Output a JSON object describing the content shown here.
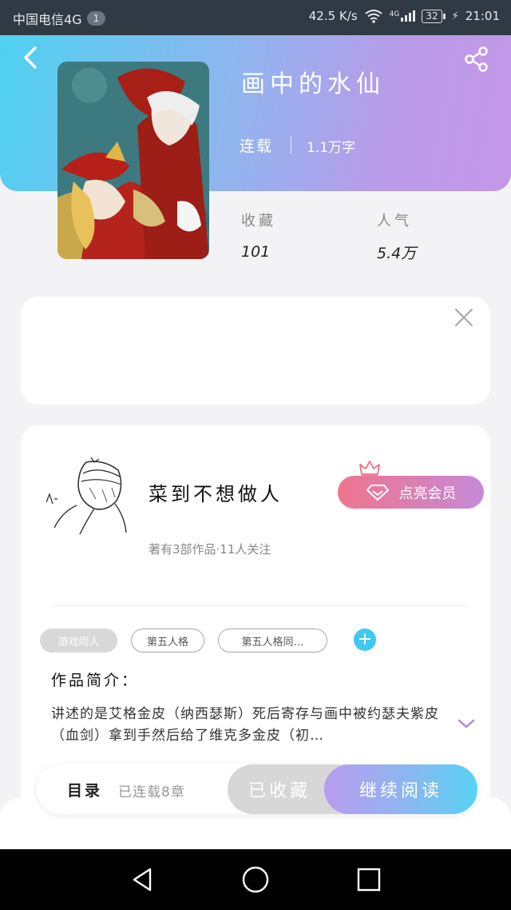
{
  "status_bar": {
    "carrier": "中国电信4G",
    "badge": "1",
    "speed": "42.5 K/s",
    "signal_label": "4G",
    "battery": "32",
    "time": "21:01"
  },
  "book": {
    "title": "画中的水仙",
    "status": "连载",
    "word_count": "1.1万字"
  },
  "stats": {
    "favorites_label": "收藏",
    "favorites_value": "101",
    "popularity_label": "人气",
    "popularity_value": "5.4万"
  },
  "author": {
    "name": "菜到不想做人",
    "meta": "著有3部作品·11人关注",
    "vip_button": "点亮会员"
  },
  "tags": [
    "游戏同人",
    "第五人格",
    "第五人格同…"
  ],
  "intro": {
    "label": "作品简介：",
    "text": "讲述的是艾格金皮（纳西瑟斯）死后寄存与画中被约瑟夫紫皮（血剑）拿到手然后给了维克多金皮（初…"
  },
  "actions": {
    "toc_label": "目录",
    "toc_count": "已连载8章",
    "collected": "已收藏",
    "continue": "继续阅读"
  },
  "icons": {
    "back": "chevron-left-icon",
    "share": "share-icon",
    "close": "close-icon",
    "crown": "crown-icon",
    "diamond": "diamond-icon",
    "add": "plus-icon",
    "expand": "chevron-down-icon"
  },
  "colors": {
    "hero_start": "#4fd1f1",
    "hero_end": "#c597e8",
    "vip_start": "#f0758e",
    "vip_end": "#c48ad9",
    "accent_blue": "#3fc8f2"
  }
}
